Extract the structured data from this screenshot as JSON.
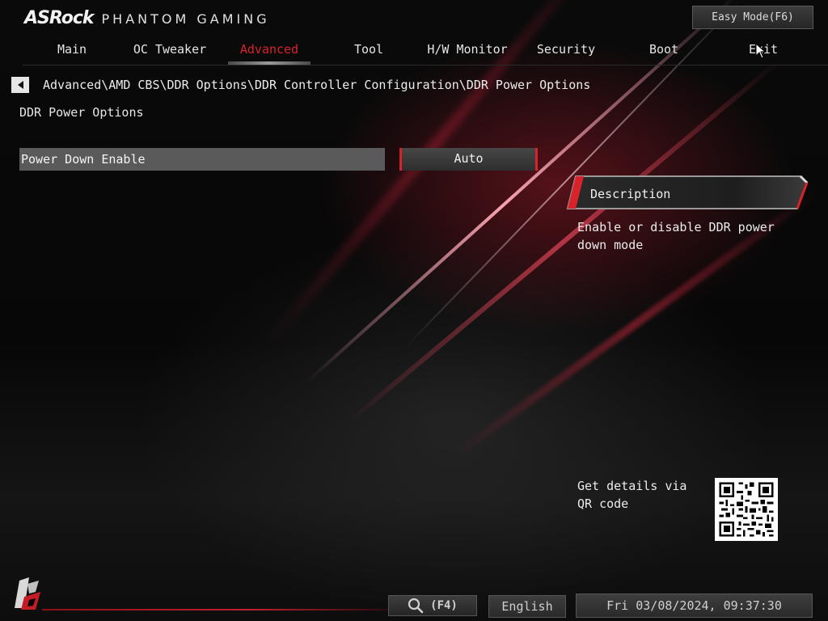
{
  "header": {
    "brand": "ASRock",
    "sub_brand": "PHANTOM GAMING",
    "easy_mode_label": "Easy Mode(F6)"
  },
  "nav": {
    "tabs": [
      {
        "label": "Main"
      },
      {
        "label": "OC Tweaker"
      },
      {
        "label": "Advanced",
        "active": true
      },
      {
        "label": "Tool"
      },
      {
        "label": "H/W Monitor"
      },
      {
        "label": "Security"
      },
      {
        "label": "Boot"
      },
      {
        "label": "Exit"
      }
    ]
  },
  "breadcrumb": "Advanced\\AMD CBS\\DDR Options\\DDR Controller Configuration\\DDR Power Options",
  "page_title": "DDR Power Options",
  "settings": [
    {
      "label": "Power Down Enable",
      "value": "Auto"
    }
  ],
  "description": {
    "title": "Description",
    "text": "Enable or disable DDR power down mode"
  },
  "qr": {
    "text": "Get details via QR code"
  },
  "footer": {
    "search_label": "(F4)",
    "language": "English",
    "datetime": "Fri 03/08/2024, 09:37:30"
  },
  "colors": {
    "accent": "#d8232a",
    "setting_row_bg": "#5a5a5a"
  }
}
